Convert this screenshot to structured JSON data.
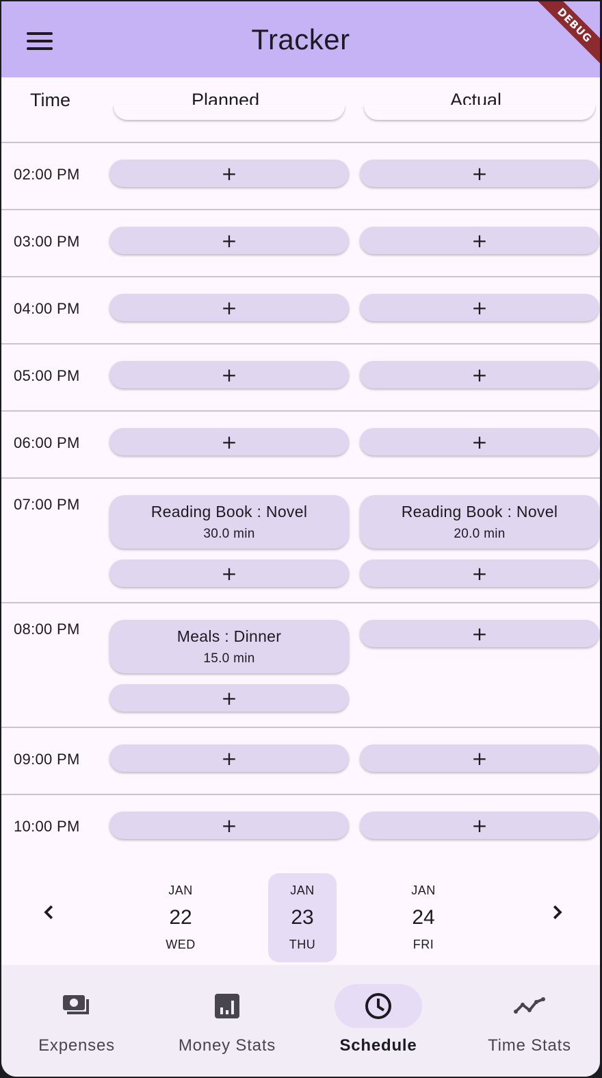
{
  "app": {
    "title": "Tracker",
    "debug_label": "DEBUG"
  },
  "header": {
    "time": "Time",
    "planned": "Planned",
    "actual": "Actual"
  },
  "add_label": "+",
  "rows": [
    {
      "time": "02:00 PM"
    },
    {
      "time": "03:00 PM"
    },
    {
      "time": "04:00 PM"
    },
    {
      "time": "05:00 PM"
    },
    {
      "time": "06:00 PM"
    },
    {
      "time": "07:00 PM",
      "planned": {
        "title": "Reading Book : Novel",
        "duration": "30.0 min"
      },
      "actual": {
        "title": "Reading Book : Novel",
        "duration": "20.0 min"
      }
    },
    {
      "time": "08:00 PM",
      "planned": {
        "title": "Meals : Dinner",
        "duration": "15.0 min"
      }
    },
    {
      "time": "09:00 PM"
    },
    {
      "time": "10:00 PM"
    }
  ],
  "dates": [
    {
      "month": "JAN",
      "day": "22",
      "weekday": "WED"
    },
    {
      "month": "JAN",
      "day": "23",
      "weekday": "THU",
      "selected": true
    },
    {
      "month": "JAN",
      "day": "24",
      "weekday": "FRI"
    }
  ],
  "nav": {
    "expenses": "Expenses",
    "money_stats": "Money Stats",
    "schedule": "Schedule",
    "time_stats": "Time Stats",
    "active": "schedule"
  },
  "colors": {
    "app_bar": "#c6b3f5",
    "button": "#e0d6f0",
    "selected": "#e6dcf6",
    "background": "#fef7ff"
  }
}
